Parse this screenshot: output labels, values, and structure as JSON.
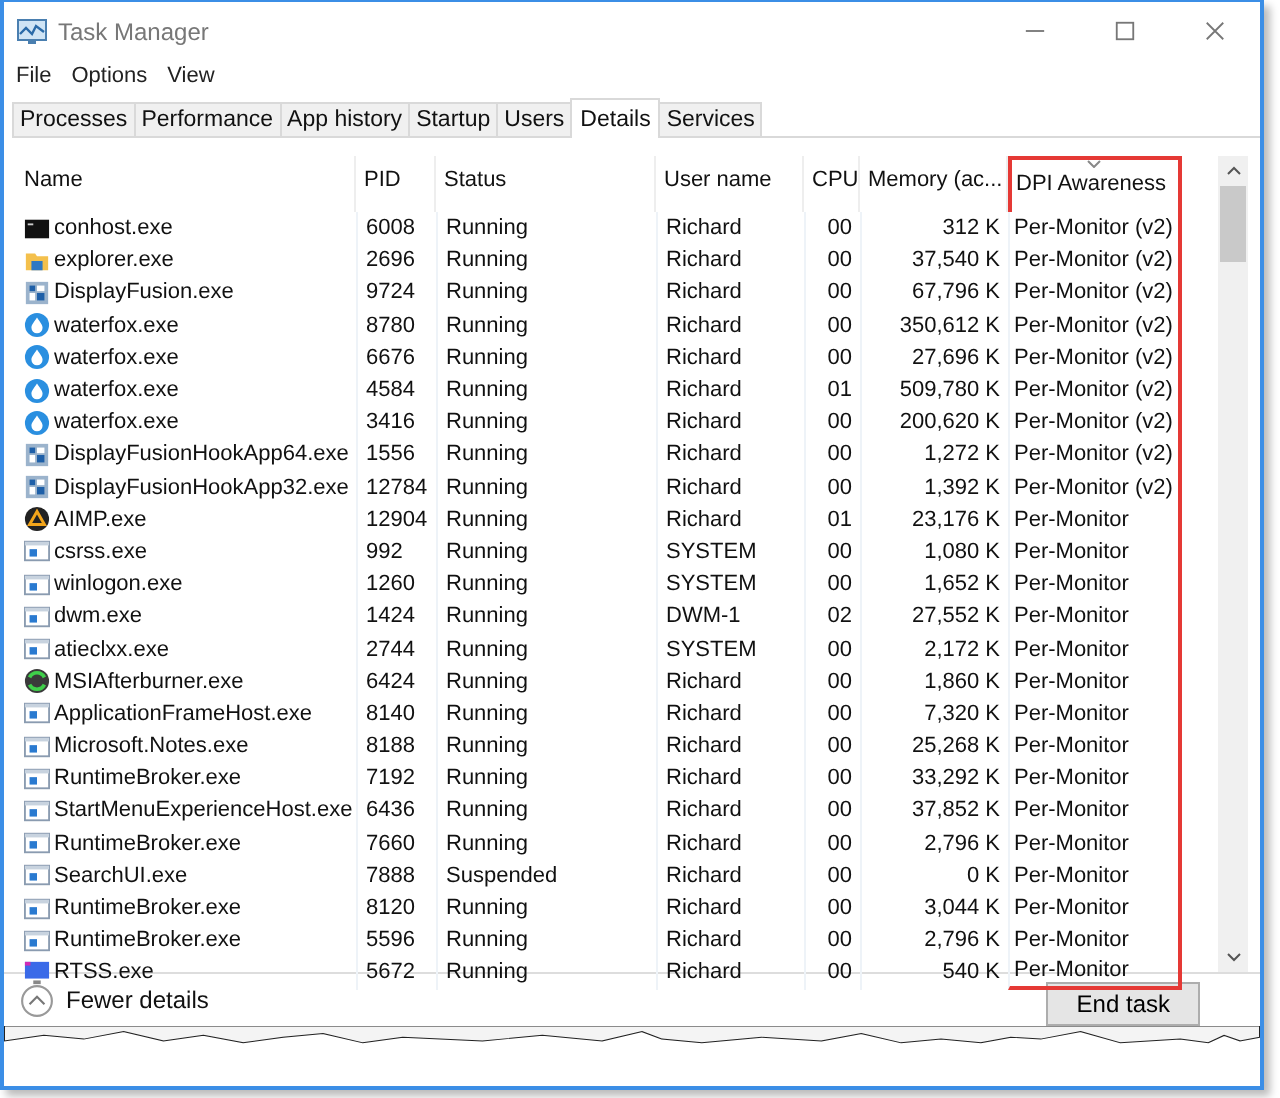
{
  "window": {
    "title": "Task Manager"
  },
  "menu": [
    "File",
    "Options",
    "View"
  ],
  "tabs": [
    {
      "label": "Processes",
      "selected": false
    },
    {
      "label": "Performance",
      "selected": false
    },
    {
      "label": "App history",
      "selected": false
    },
    {
      "label": "Startup",
      "selected": false
    },
    {
      "label": "Users",
      "selected": false
    },
    {
      "label": "Details",
      "selected": true
    },
    {
      "label": "Services",
      "selected": false
    }
  ],
  "table": {
    "columns": [
      {
        "label": "Name",
        "highlighted": false,
        "sorted": false
      },
      {
        "label": "PID",
        "highlighted": false,
        "sorted": false
      },
      {
        "label": "Status",
        "highlighted": false,
        "sorted": false
      },
      {
        "label": "User name",
        "highlighted": false,
        "sorted": false
      },
      {
        "label": "CPU",
        "highlighted": false,
        "sorted": false
      },
      {
        "label": "Memory (ac...",
        "highlighted": false,
        "sorted": false
      },
      {
        "label": "DPI Awareness",
        "highlighted": true,
        "sorted": true
      }
    ],
    "rows": [
      {
        "kind": "console",
        "cells": [
          "conhost.exe",
          "6008",
          "Running",
          "Richard",
          "00",
          "312 K",
          "Per-Monitor (v2)"
        ]
      },
      {
        "kind": "folder",
        "cells": [
          "explorer.exe",
          "2696",
          "Running",
          "Richard",
          "00",
          "37,540 K",
          "Per-Monitor (v2)"
        ]
      },
      {
        "kind": "fusion",
        "cells": [
          "DisplayFusion.exe",
          "9724",
          "Running",
          "Richard",
          "00",
          "67,796 K",
          "Per-Monitor (v2)"
        ]
      },
      {
        "kind": "waterfox",
        "cells": [
          "waterfox.exe",
          "8780",
          "Running",
          "Richard",
          "00",
          "350,612 K",
          "Per-Monitor (v2)"
        ]
      },
      {
        "kind": "waterfox",
        "cells": [
          "waterfox.exe",
          "6676",
          "Running",
          "Richard",
          "00",
          "27,696 K",
          "Per-Monitor (v2)"
        ]
      },
      {
        "kind": "waterfox",
        "cells": [
          "waterfox.exe",
          "4584",
          "Running",
          "Richard",
          "01",
          "509,780 K",
          "Per-Monitor (v2)"
        ]
      },
      {
        "kind": "waterfox",
        "cells": [
          "waterfox.exe",
          "3416",
          "Running",
          "Richard",
          "00",
          "200,620 K",
          "Per-Monitor (v2)"
        ]
      },
      {
        "kind": "fusion",
        "cells": [
          "DisplayFusionHookApp64.exe",
          "1556",
          "Running",
          "Richard",
          "00",
          "1,272 K",
          "Per-Monitor (v2)"
        ]
      },
      {
        "kind": "fusion",
        "cells": [
          "DisplayFusionHookApp32.exe",
          "12784",
          "Running",
          "Richard",
          "00",
          "1,392 K",
          "Per-Monitor (v2)"
        ]
      },
      {
        "kind": "aimp",
        "cells": [
          "AIMP.exe",
          "12904",
          "Running",
          "Richard",
          "01",
          "23,176 K",
          "Per-Monitor"
        ]
      },
      {
        "kind": "window",
        "cells": [
          "csrss.exe",
          "992",
          "Running",
          "SYSTEM",
          "00",
          "1,080 K",
          "Per-Monitor"
        ]
      },
      {
        "kind": "window",
        "cells": [
          "winlogon.exe",
          "1260",
          "Running",
          "SYSTEM",
          "00",
          "1,652 K",
          "Per-Monitor"
        ]
      },
      {
        "kind": "window",
        "cells": [
          "dwm.exe",
          "1424",
          "Running",
          "DWM-1",
          "02",
          "27,552 K",
          "Per-Monitor"
        ]
      },
      {
        "kind": "window",
        "cells": [
          "atieclxx.exe",
          "2744",
          "Running",
          "SYSTEM",
          "00",
          "2,172 K",
          "Per-Monitor"
        ]
      },
      {
        "kind": "msi",
        "cells": [
          "MSIAfterburner.exe",
          "6424",
          "Running",
          "Richard",
          "00",
          "1,860 K",
          "Per-Monitor"
        ]
      },
      {
        "kind": "window",
        "cells": [
          "ApplicationFrameHost.exe",
          "8140",
          "Running",
          "Richard",
          "00",
          "7,320 K",
          "Per-Monitor"
        ]
      },
      {
        "kind": "window",
        "cells": [
          "Microsoft.Notes.exe",
          "8188",
          "Running",
          "Richard",
          "00",
          "25,268 K",
          "Per-Monitor"
        ]
      },
      {
        "kind": "window",
        "cells": [
          "RuntimeBroker.exe",
          "7192",
          "Running",
          "Richard",
          "00",
          "33,292 K",
          "Per-Monitor"
        ]
      },
      {
        "kind": "window",
        "cells": [
          "StartMenuExperienceHost.exe",
          "6436",
          "Running",
          "Richard",
          "00",
          "37,852 K",
          "Per-Monitor"
        ]
      },
      {
        "kind": "window",
        "cells": [
          "RuntimeBroker.exe",
          "7660",
          "Running",
          "Richard",
          "00",
          "2,796 K",
          "Per-Monitor"
        ]
      },
      {
        "kind": "window",
        "cells": [
          "SearchUI.exe",
          "7888",
          "Suspended",
          "Richard",
          "00",
          "0 K",
          "Per-Monitor"
        ]
      },
      {
        "kind": "window",
        "cells": [
          "RuntimeBroker.exe",
          "8120",
          "Running",
          "Richard",
          "00",
          "3,044 K",
          "Per-Monitor"
        ]
      },
      {
        "kind": "window",
        "cells": [
          "RuntimeBroker.exe",
          "5596",
          "Running",
          "Richard",
          "00",
          "2,796 K",
          "Per-Monitor"
        ]
      },
      {
        "kind": "monitor",
        "cells": [
          "RTSS.exe",
          "5672",
          "Running",
          "Richard",
          "00",
          "540 K",
          "Per-Monitor"
        ]
      }
    ]
  },
  "footer": {
    "toggle": "Fewer details",
    "button": "End task"
  }
}
